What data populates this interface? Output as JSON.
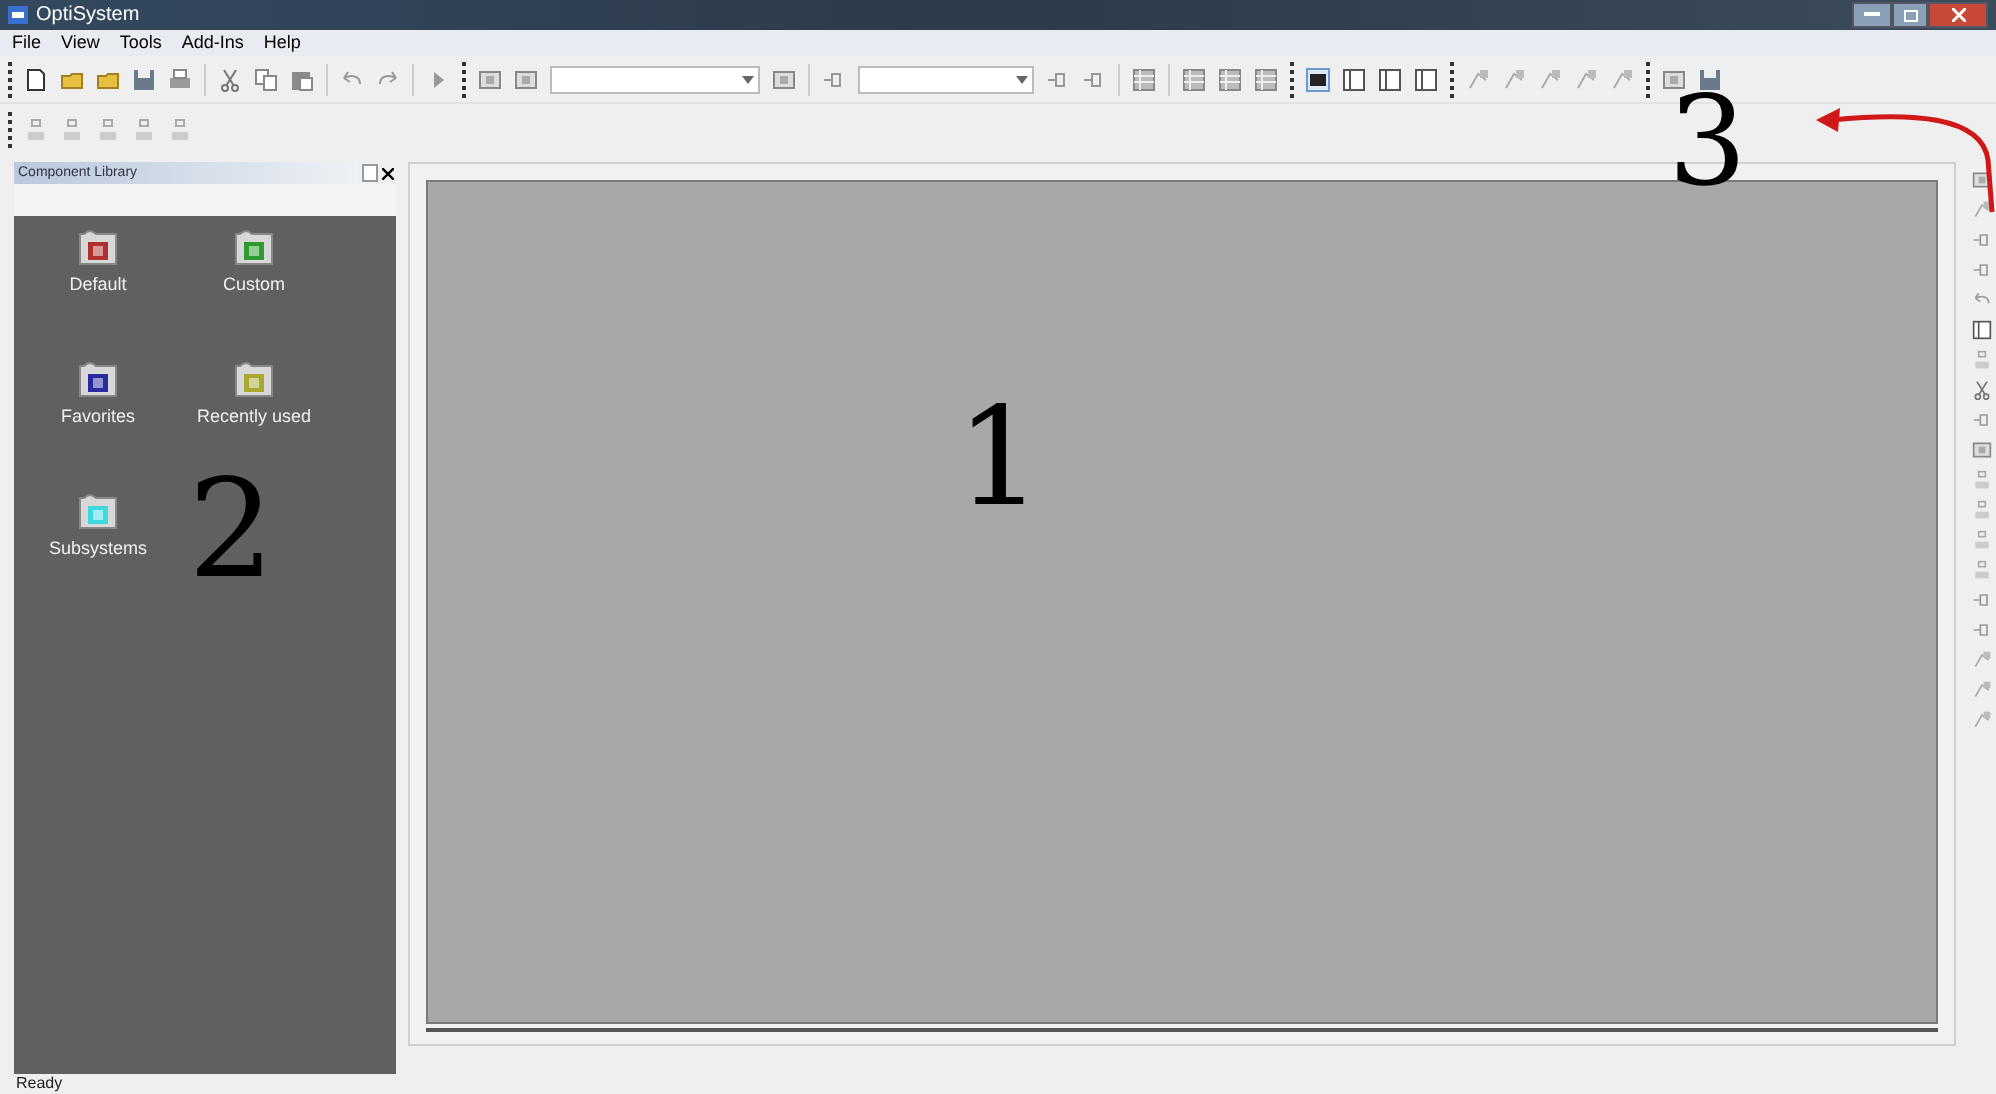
{
  "window": {
    "title": "OptiSystem"
  },
  "menu": [
    {
      "label": "File"
    },
    {
      "label": "View"
    },
    {
      "label": "Tools"
    },
    {
      "label": "Add-Ins"
    },
    {
      "label": "Help"
    }
  ],
  "component_library": {
    "title": "Component Library",
    "folders": [
      {
        "label": "Default",
        "color": "#b03030"
      },
      {
        "label": "Custom",
        "color": "#2e9a2e"
      },
      {
        "label": "Favorites",
        "color": "#2a2aa0"
      },
      {
        "label": "Recently used",
        "color": "#a8a830"
      },
      {
        "label": "Subsystems",
        "color": "#40d8e0"
      }
    ]
  },
  "status_bar": {
    "text": "Ready"
  },
  "annotations": [
    {
      "label": "1"
    },
    {
      "label": "2"
    },
    {
      "label": "3"
    }
  ]
}
